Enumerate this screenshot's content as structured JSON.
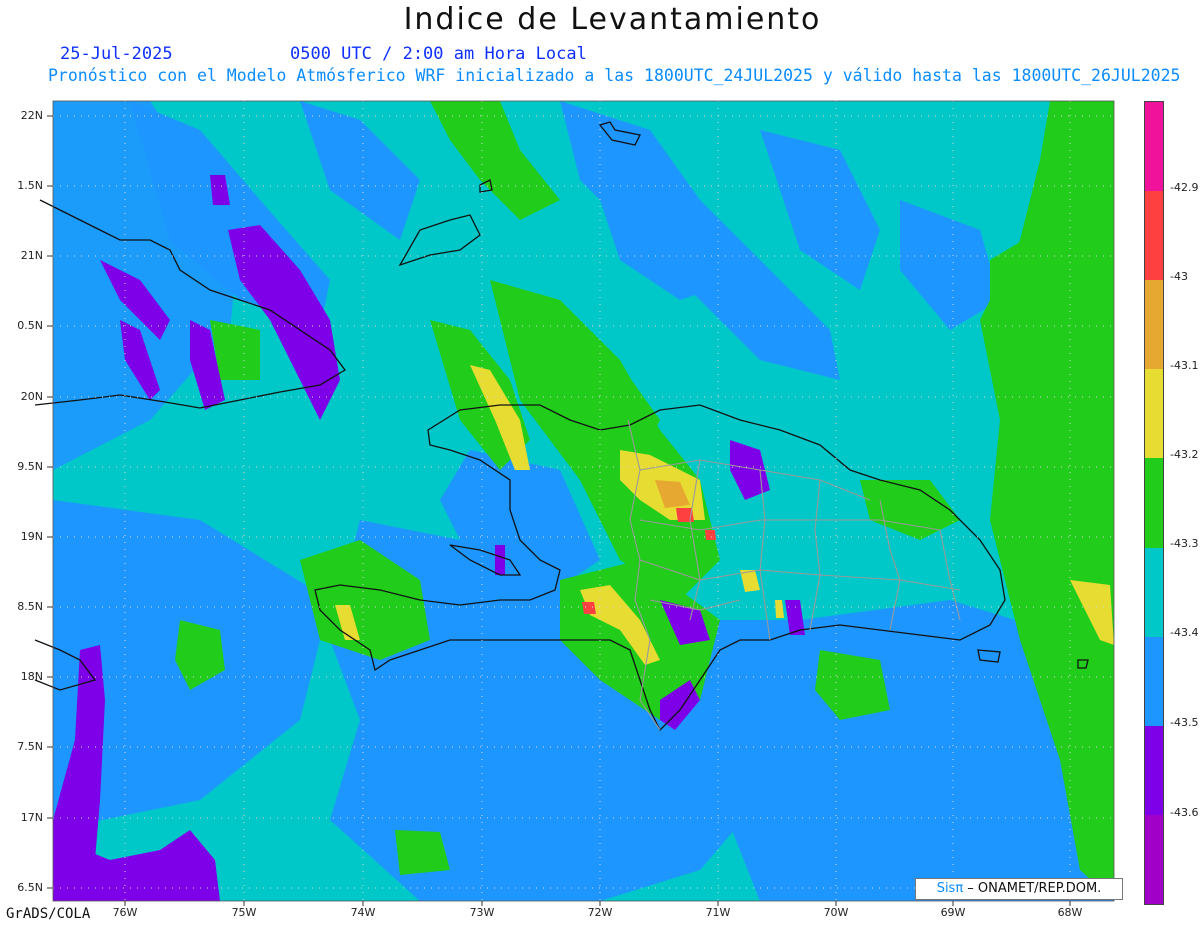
{
  "header": {
    "title": "Indice de Levantamiento",
    "date": "25-Jul-2025",
    "valid_time": "0500 UTC / 2:00 am Hora Local",
    "subtitle": "Pronóstico con el Modelo Atmósferico WRF inicializado a las 1800UTC_24JUL2025 y válido hasta las  1800UTC_26JUL2025"
  },
  "footer": {
    "software": "GrADS/COLA",
    "credit_prefix": "Sisπ",
    "credit": " – ONAMET/REP.DOM."
  },
  "map": {
    "lat_labels": [
      "22N",
      "1.5N",
      "21N",
      "0.5N",
      "20N",
      "9.5N",
      "19N",
      "8.5N",
      "18N",
      "7.5N",
      "17N",
      "6.5N"
    ],
    "lon_labels": [
      "76W",
      "75W",
      "74W",
      "73W",
      "72W",
      "71W",
      "70W",
      "69W",
      "68W"
    ]
  },
  "colorbar": {
    "labels": [
      "-42.9",
      "-43",
      "-43.1",
      "-43.2",
      "-43.3",
      "-43.4",
      "-43.5",
      "-43.6"
    ],
    "colors": [
      "#f0129a",
      "#ff4040",
      "#e6a830",
      "#e6dc32",
      "#22cc1a",
      "#00c8c8",
      "#1e96ff",
      "#7d00e8",
      "#a000c8"
    ]
  }
}
